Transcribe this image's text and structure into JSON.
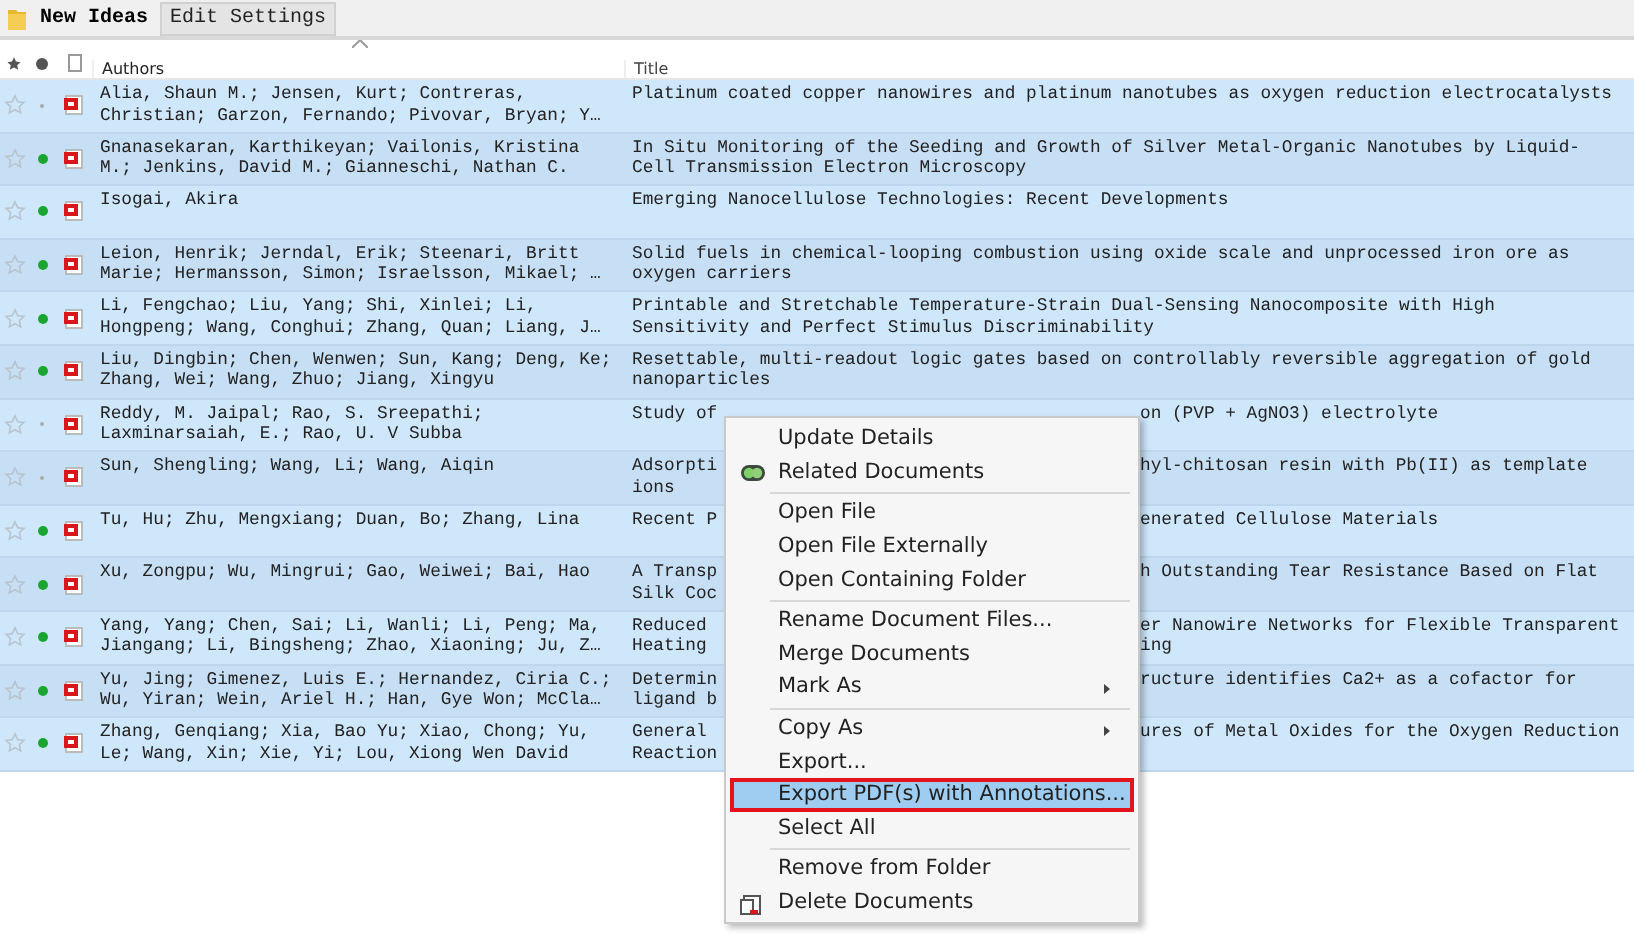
{
  "toolbar": {
    "folder_title": "New Ideas",
    "edit_button": "Edit Settings"
  },
  "table": {
    "columns": [
      {
        "kind": "star"
      },
      {
        "kind": "read"
      },
      {
        "kind": "file"
      },
      {
        "kind": "text",
        "label": "Authors",
        "sorted": true
      },
      {
        "kind": "text",
        "label": "Title",
        "sorted": false
      }
    ],
    "rows": [
      {
        "starred": false,
        "unread": false,
        "authors": "Alia, Shaun M.; Jensen, Kurt; Contreras,\nChristian; Garzon, Fernando; Pivovar, Bryan; Y…",
        "title": "Platinum coated copper nanowires and platinum nanotubes as oxygen reduction electrocatalysts"
      },
      {
        "starred": false,
        "unread": true,
        "authors": "Gnanasekaran, Karthikeyan; Vailonis, Kristina\nM.; Jenkins, David M.; Gianneschi, Nathan C.",
        "title": "In Situ Monitoring of the Seeding and Growth of Silver Metal-Organic Nanotubes by Liquid-\nCell Transmission Electron Microscopy"
      },
      {
        "starred": false,
        "unread": true,
        "authors": "Isogai, Akira",
        "title": "Emerging Nanocellulose Technologies: Recent Developments"
      },
      {
        "starred": false,
        "unread": true,
        "authors": "Leion, Henrik; Jerndal, Erik; Steenari, Britt\nMarie; Hermansson, Simon; Israelsson, Mikael; …",
        "title": "Solid fuels in chemical-looping combustion using oxide scale and unprocessed iron ore as\noxygen carriers"
      },
      {
        "starred": false,
        "unread": true,
        "authors": "Li, Fengchao; Liu, Yang; Shi, Xinlei; Li,\nHongpeng; Wang, Conghui; Zhang, Quan; Liang, J…",
        "title": "Printable and Stretchable Temperature-Strain Dual-Sensing Nanocomposite with High\nSensitivity and Perfect Stimulus Discriminability"
      },
      {
        "starred": false,
        "unread": true,
        "authors": "Liu, Dingbin; Chen, Wenwen; Sun, Kang; Deng, Ke;\nZhang, Wei; Wang, Zhuo; Jiang, Xingyu",
        "title": "Resettable, multi-readout logic gates based on controllably reversible aggregation of gold\nnanoparticles"
      },
      {
        "starred": false,
        "unread": false,
        "authors": "Reddy, M. Jaipal; Rao, S. Sreepathi;\nLaxminarsaiah, E.; Rao, U. V Subba",
        "title_left": "Study of",
        "title_right": "on (PVP + AgNO3) electrolyte"
      },
      {
        "starred": false,
        "unread": false,
        "authors": "Sun, Shengling; Wang, Li; Wang, Aiqin",
        "title_left": "Adsorpti\nions",
        "title_right": "hyl-chitosan resin with Pb(II) as template"
      },
      {
        "starred": false,
        "unread": true,
        "authors": "Tu, Hu; Zhu, Mengxiang; Duan, Bo; Zhang, Lina",
        "title_left": "Recent P",
        "title_right": "enerated Cellulose Materials"
      },
      {
        "starred": false,
        "unread": true,
        "authors": "Xu, Zongpu; Wu, Mingrui; Gao, Weiwei; Bai, Hao",
        "title_left": "A Transp\nSilk Coc",
        "title_right": "h Outstanding Tear Resistance Based on Flat"
      },
      {
        "starred": false,
        "unread": true,
        "authors": "Yang, Yang; Chen, Sai; Li, Wanli; Li, Peng; Ma,\nJiangang; Li, Bingsheng; Zhao, Xiaoning; Ju, Z…",
        "title_left": "Reduced\nHeating",
        "title_right": "er Nanowire Networks for Flexible Transparent\ning"
      },
      {
        "starred": false,
        "unread": true,
        "authors": "Yu, Jing; Gimenez, Luis E.; Hernandez, Ciria C.;\nWu, Yiran; Wein, Ariel H.; Han, Gye Won; McCla…",
        "title_left": "Determin\nligand b",
        "title_right": "ructure identifies Ca2+ as a cofactor for"
      },
      {
        "starred": false,
        "unread": true,
        "authors": "Zhang, Genqiang; Xia, Bao Yu; Xiao, Chong; Yu,\nLe; Wang, Xin; Xie, Yi; Lou, Xiong Wen David",
        "title_left": "General\nReaction",
        "title_right": "ures of Metal Oxides for the Oxygen Reduction"
      }
    ]
  },
  "context_menu": [
    {
      "kind": "item",
      "label": "Update Details",
      "selected": false
    },
    {
      "kind": "related",
      "label": "Related Documents",
      "selected": false
    },
    {
      "kind": "separator"
    },
    {
      "kind": "item",
      "label": "Open File",
      "selected": false
    },
    {
      "kind": "item",
      "label": "Open File Externally",
      "selected": false
    },
    {
      "kind": "item",
      "label": "Open Containing Folder",
      "selected": false
    },
    {
      "kind": "separator"
    },
    {
      "kind": "item",
      "label": "Rename Document Files...",
      "selected": false
    },
    {
      "kind": "item",
      "label": "Merge Documents",
      "selected": false
    },
    {
      "kind": "item",
      "label": "Mark As",
      "submenu": true,
      "selected": false
    },
    {
      "kind": "separator"
    },
    {
      "kind": "item",
      "label": "Copy As",
      "submenu": true,
      "selected": false
    },
    {
      "kind": "item",
      "label": "Export...",
      "selected": false
    },
    {
      "kind": "item",
      "label": "Export PDF(s) with Annotations...",
      "selected": true
    },
    {
      "kind": "item",
      "label": "Select All",
      "selected": false
    },
    {
      "kind": "separator"
    },
    {
      "kind": "item",
      "label": "Remove from Folder",
      "selected": false
    },
    {
      "kind": "delete",
      "label": "Delete Documents",
      "selected": false
    }
  ]
}
